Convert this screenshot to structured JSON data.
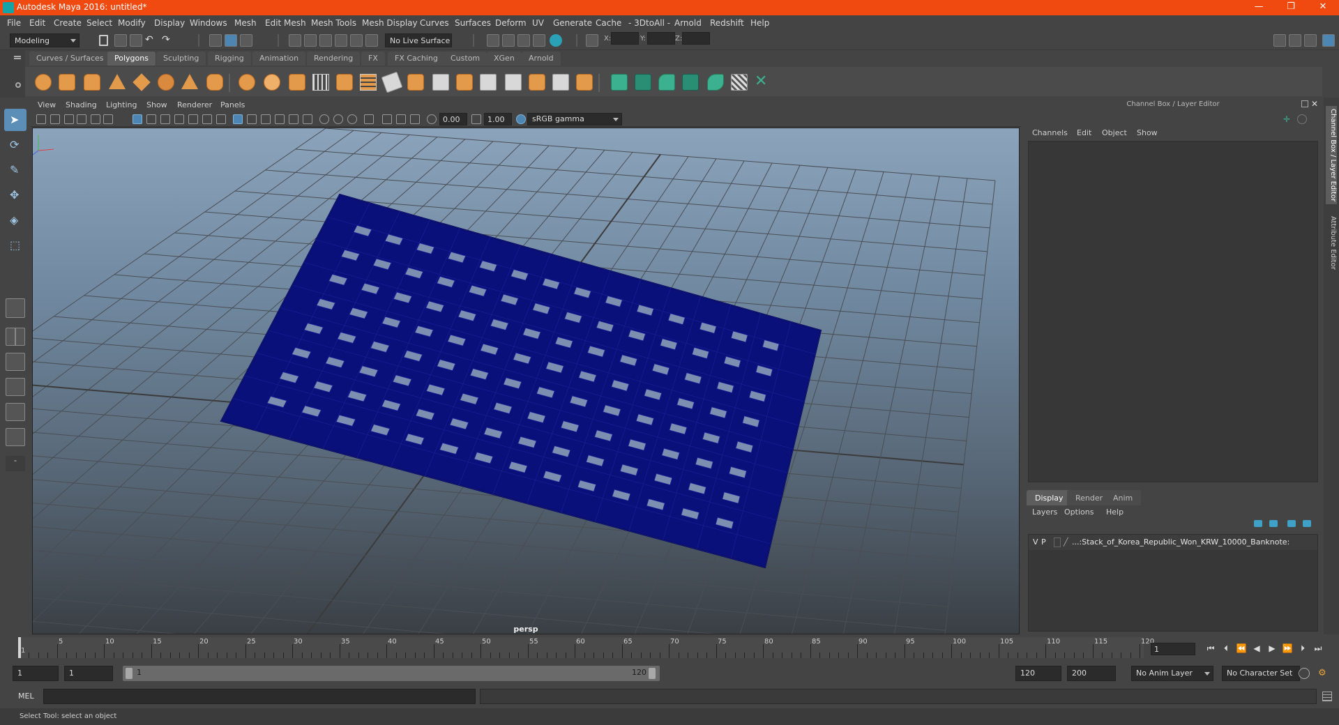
{
  "app": {
    "title": "Autodesk Maya 2016: untitled*",
    "window_controls": {
      "minimize": "—",
      "restore": "❐",
      "close": "✕"
    }
  },
  "menubar": [
    "File",
    "Edit",
    "Create",
    "Select",
    "Modify",
    "Display",
    "Windows",
    "Mesh",
    "Edit Mesh",
    "Mesh Tools",
    "Mesh Display",
    "Curves",
    "Surfaces",
    "Deform",
    "UV",
    "Generate",
    "Cache",
    "- 3DtoAll -",
    "Arnold",
    "Redshift",
    "Help"
  ],
  "statusline": {
    "mode": "Modeling",
    "live_surface": "No Live Surface",
    "x_label": "X:",
    "y_label": "Y:",
    "z_label": "Z:"
  },
  "shelf": {
    "tabs": [
      "Curves / Surfaces",
      "Polygons",
      "Sculpting",
      "Rigging",
      "Animation",
      "Rendering",
      "FX",
      "FX Caching",
      "Custom",
      "XGen",
      "Arnold"
    ],
    "active_tab": "Polygons"
  },
  "viewport": {
    "menu": [
      "View",
      "Shading",
      "Lighting",
      "Show",
      "Renderer",
      "Panels"
    ],
    "exposure": "0.00",
    "gamma": "1.00",
    "color_space": "sRGB gamma",
    "camera": "persp"
  },
  "right_panel": {
    "title": "Channel Box / Layer Editor",
    "menu": [
      "Channels",
      "Edit",
      "Object",
      "Show"
    ],
    "layer_tabs": [
      "Display",
      "Render",
      "Anim"
    ],
    "active_layer_tab": "Display",
    "layer_menu": [
      "Layers",
      "Options",
      "Help"
    ],
    "layer": {
      "v": "V",
      "p": "P",
      "name": "...:Stack_of_Korea_Republic_Won_KRW_10000_Banknote:"
    },
    "side_tabs": [
      "Channel Box / Layer Editor",
      "Attribute Editor"
    ]
  },
  "timeline": {
    "ticks": [
      "1",
      "5",
      "10",
      "15",
      "20",
      "25",
      "30",
      "35",
      "40",
      "45",
      "50",
      "55",
      "60",
      "65",
      "70",
      "75",
      "80",
      "85",
      "90",
      "95",
      "100",
      "105",
      "110",
      "115",
      "120"
    ],
    "current_frame": "1",
    "current_frame_value": 1,
    "max_frame_value": 120
  },
  "range": {
    "start": "1",
    "playback_start": "1",
    "slider_start_label": "1",
    "slider_end_label": "120",
    "playback_end": "120",
    "end": "200",
    "anim_layer": "No Anim Layer",
    "character_set": "No Character Set"
  },
  "commandline": {
    "lang": "MEL",
    "help": "Select Tool: select an object"
  },
  "colors": {
    "titlebar": "#f04a10",
    "model_wire": "#0a107a",
    "accent": "#5c8fb8"
  }
}
